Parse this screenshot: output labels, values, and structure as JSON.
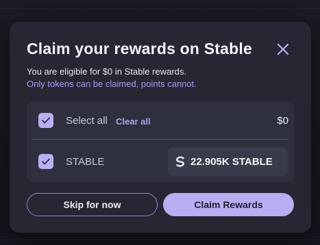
{
  "modal": {
    "title": "Claim your rewards on Stable",
    "subtitle": "You are eligible for $0 in Stable rewards.",
    "note": "Only tokens can be claimed, points cannot.",
    "select_all_label": "Select all",
    "clear_all_label": "Clear all",
    "total": "$0",
    "token": {
      "name": "STABLE",
      "amount": "22.905K STABLE",
      "icon": "stable-logo-icon",
      "checked": true
    },
    "select_all_checked": true,
    "skip_label": "Skip for now",
    "claim_label": "Claim Rewards"
  },
  "colors": {
    "accent": "#b7aef4",
    "modal_bg": "#262733",
    "panel_bg": "#2f303d",
    "note_text": "#a59df5"
  }
}
